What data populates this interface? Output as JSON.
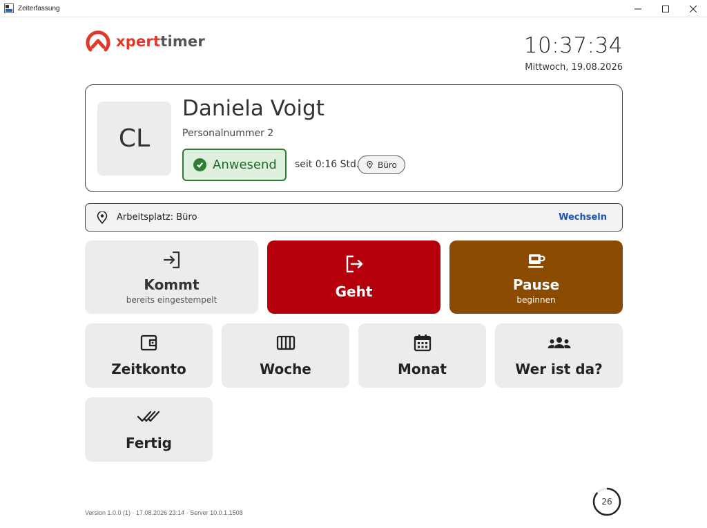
{
  "window": {
    "title": "Zeiterfassung"
  },
  "header": {
    "logo_brand_a": "xpert",
    "logo_brand_b": "timer",
    "time": "10:37:34",
    "date": "Mittwoch, 19.08.2026"
  },
  "profile": {
    "initials": "CL",
    "name": "Daniela Voigt",
    "personnel_number": "Personalnummer 2",
    "status": "Anwesend",
    "since": "seit 0:16 Std.",
    "location_chip": "Büro"
  },
  "workplace": {
    "label": "Arbeitsplatz: Büro",
    "change_label": "Wechseln"
  },
  "actions": {
    "kommt": {
      "title": "Kommt",
      "subtitle": "bereits eingestempelt",
      "icon": "login-icon"
    },
    "geht": {
      "title": "Geht",
      "icon": "logout-icon"
    },
    "pause": {
      "title": "Pause",
      "subtitle": "beginnen",
      "icon": "coffee-icon"
    },
    "zeitkonto": {
      "title": "Zeitkonto",
      "icon": "wallet-icon"
    },
    "woche": {
      "title": "Woche",
      "icon": "week-columns-icon"
    },
    "monat": {
      "title": "Monat",
      "icon": "calendar-icon"
    },
    "wer": {
      "title": "Wer ist da?",
      "icon": "group-icon"
    },
    "fertig": {
      "title": "Fertig",
      "icon": "double-check-icon"
    }
  },
  "footer": {
    "version": "Version 1.0.0 (1)  ·  17.08.2026 23:14  ·  Server 10.0.1.1508",
    "countdown": "26",
    "countdown_progress": 0.87
  },
  "colors": {
    "geht": "#b5000b",
    "pause": "#8a4a00",
    "present": "#2e7d32",
    "link": "#1c53b8",
    "brand": "#e0392b"
  }
}
